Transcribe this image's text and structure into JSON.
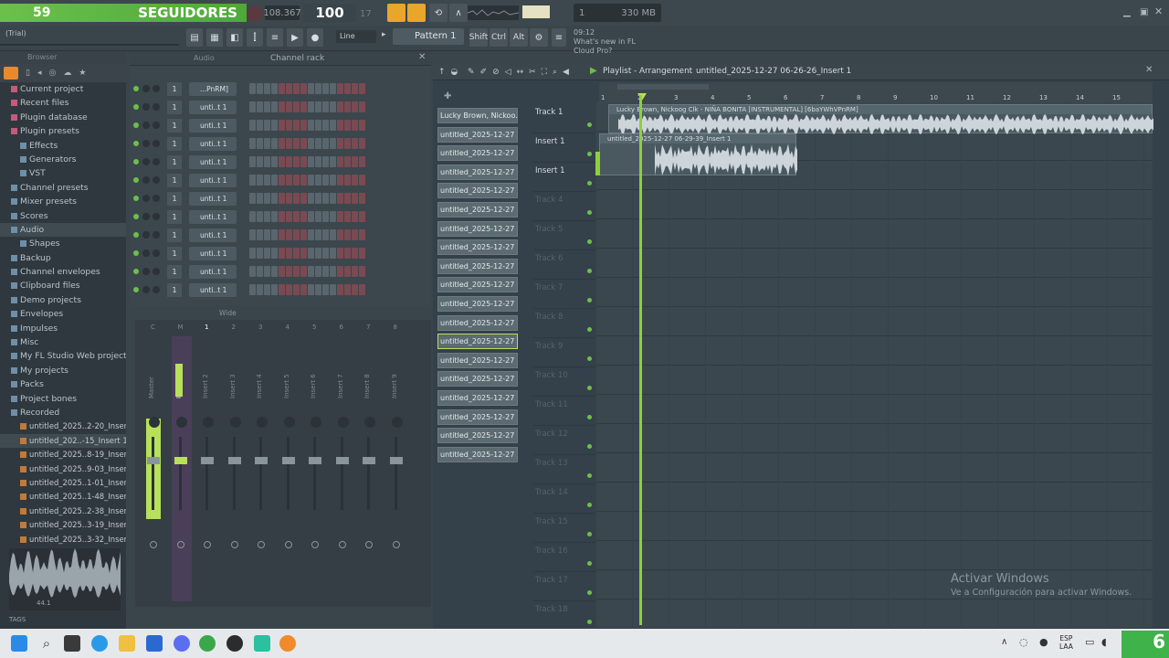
{
  "overlay": {
    "followers_count": "59",
    "followers_label": "SEGUIDORES"
  },
  "transport": {
    "time": "108.367",
    "tempo": "100",
    "tempo_frac": "17",
    "cpu_value": "1",
    "mem": "330 MB",
    "mem_sub": "2"
  },
  "toolbar2": {
    "trial": "(Trial)",
    "line_mode": "Line",
    "pattern": "Pattern 1",
    "shift": "Shift",
    "ctrl": "Ctrl",
    "alt": "Alt",
    "news_time": "09:12",
    "news_text": "What's new in FL Cloud Pro?"
  },
  "browser": {
    "title": "Browser",
    "items": [
      "Current project",
      "Recent files",
      "Plugin database",
      "Plugin presets",
      "Effects",
      "Generators",
      "VST",
      "Channel presets",
      "Mixer presets",
      "Scores",
      "Audio",
      "Shapes",
      "Backup",
      "Channel envelopes",
      "Clipboard files",
      "Demo projects",
      "Envelopes",
      "Impulses",
      "Misc",
      "My FL Studio Web projects",
      "My projects",
      "Packs",
      "Project bones",
      "Recorded",
      "untitled_2025..2-20_Insert 1",
      "untitled_202..-15_Insert 1",
      "untitled_2025..8-19_Insert 1",
      "untitled_2025..9-03_Insert 1",
      "untitled_2025..1-01_Insert 1",
      "untitled_2025..1-48_Insert 1",
      "untitled_2025..2-38_Insert 1",
      "untitled_2025..3-19_Insert 1",
      "untitled_2025..3-32_Insert 1"
    ],
    "tags": "TAGS",
    "sample_info": "44.1"
  },
  "channel_rack": {
    "title": "Channel rack",
    "group": "Audio",
    "channels": [
      "...PnRM]",
      "unti..t 1",
      "unti..t 1",
      "unti..t 1",
      "unti..t 1",
      "unti..t 1",
      "unti..t 1",
      "unti..t 1",
      "unti..t 1",
      "unti..t 1",
      "unti..t 1",
      "unti..t 1"
    ],
    "num": "1"
  },
  "mixer": {
    "mode": "Wide",
    "strip_labels": [
      "Master",
      "Insert 1",
      "Insert 2",
      "Insert 3",
      "Insert 4",
      "Insert 5",
      "Insert 6",
      "Insert 7",
      "Insert 8",
      "Insert 9"
    ],
    "numbers": [
      "C",
      "M",
      "1",
      "2",
      "3",
      "4",
      "5",
      "6",
      "7",
      "8"
    ]
  },
  "playlist": {
    "title": "Playlist - Arrangement",
    "breadcrumb": "untitled_2025-12-27 06-26-26_Insert 1",
    "ruler": [
      "1",
      "2",
      "3",
      "4",
      "5",
      "6",
      "7",
      "8",
      "9",
      "10",
      "11",
      "12",
      "13",
      "14",
      "15"
    ],
    "clip1": "Lucky Brown, Nickoog Clk - NIÑA BONITA [INSTRUMENTAL] [6baYWhVPnRM]",
    "clip2": "untitled_2025-12-27 06-29-39_Insert 1",
    "tracks": [
      "Track 1",
      "Insert 1",
      "Insert 1",
      "Track 4",
      "Track 5",
      "Track 6",
      "Track 7",
      "Track 8",
      "Track 9",
      "Track 10",
      "Track 11",
      "Track 12",
      "Track 13",
      "Track 14",
      "Track 15",
      "Track 16",
      "Track 17",
      "Track 18"
    ]
  },
  "pattern_picker": [
    "Lucky Brown, Nickoo..",
    "untitled_2025-12-27 06-",
    "untitled_2025-12-27 06-",
    "untitled_2025-12-27 06-",
    "untitled_2025-12-27 06-",
    "untitled_2025-12-27 06-",
    "untitled_2025-12-27 06-",
    "untitled_2025-12-27 06-",
    "untitled_2025-12-27 06-",
    "untitled_2025-12-27 06-",
    "untitled_2025-12-27 06-",
    "untitled_2025-12-27 06-",
    "untitled_2025-12-27 06-",
    "untitled_2025-12-27 06-",
    "untitled_2025-12-27 06-",
    "untitled_2025-12-27 06-",
    "untitled_2025-12-27 06-",
    "untitled_2025-12-27 06-",
    "untitled_2025-12-27 06-"
  ],
  "watermark": {
    "line1": "Activar Windows",
    "line2": "Ve a Configuración para activar Windows."
  },
  "taskbar": {
    "lang1": "ESP",
    "lang2": "LAA",
    "badge": "6"
  },
  "colors": {
    "accent": "#6cc04a",
    "step_red": "#7a4a52",
    "step_gray": "#5a666d"
  }
}
